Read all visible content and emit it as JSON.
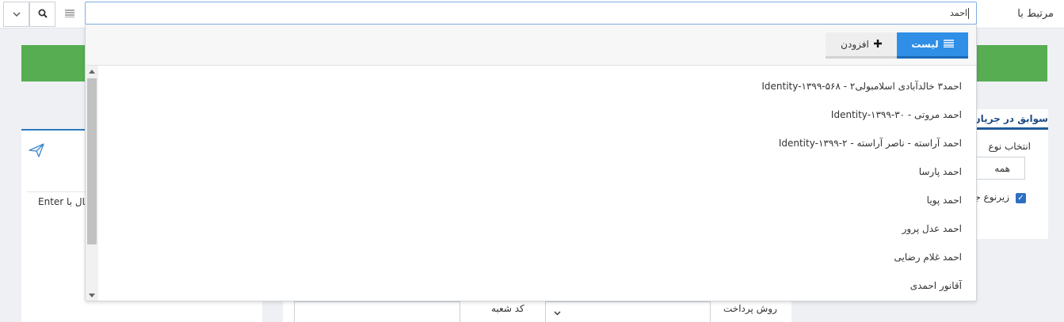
{
  "header": {
    "related_label": "مرتبط با"
  },
  "search": {
    "value": "احمد"
  },
  "dropdown": {
    "tabs": {
      "list_label": "لیست",
      "add_label": "افزودن"
    },
    "items": [
      "احمد۳ خالدآبادی اسلامبولی۲ - Identity-۱۳۹۹-۵۶۸",
      "احمد مروتی - Identity-۱۳۹۹-۳۰",
      "احمد آراسته - ناصر آراسته - Identity-۱۳۹۹-۲",
      "احمد پارسا",
      "احمد پویا",
      "احمد عدل پرور",
      "احمد غلام رضایی",
      "آقانور احمدی"
    ]
  },
  "left_panel": {
    "enter_label": "ارسال با Enter"
  },
  "right_panel": {
    "history_tab": "سوابق در جریان",
    "type_label": "انتخاب نوع",
    "type_value": "همه",
    "subtype_label": "زیرنوع جا",
    "subtype_checked": true
  },
  "bottom_form": {
    "branch_code_label": "کد شعبه",
    "payment_method_label": "روش پرداخت"
  },
  "colors": {
    "accent": "#2f8fe6",
    "success_bar": "#56ad52",
    "panel_border": "#2f79bb"
  }
}
